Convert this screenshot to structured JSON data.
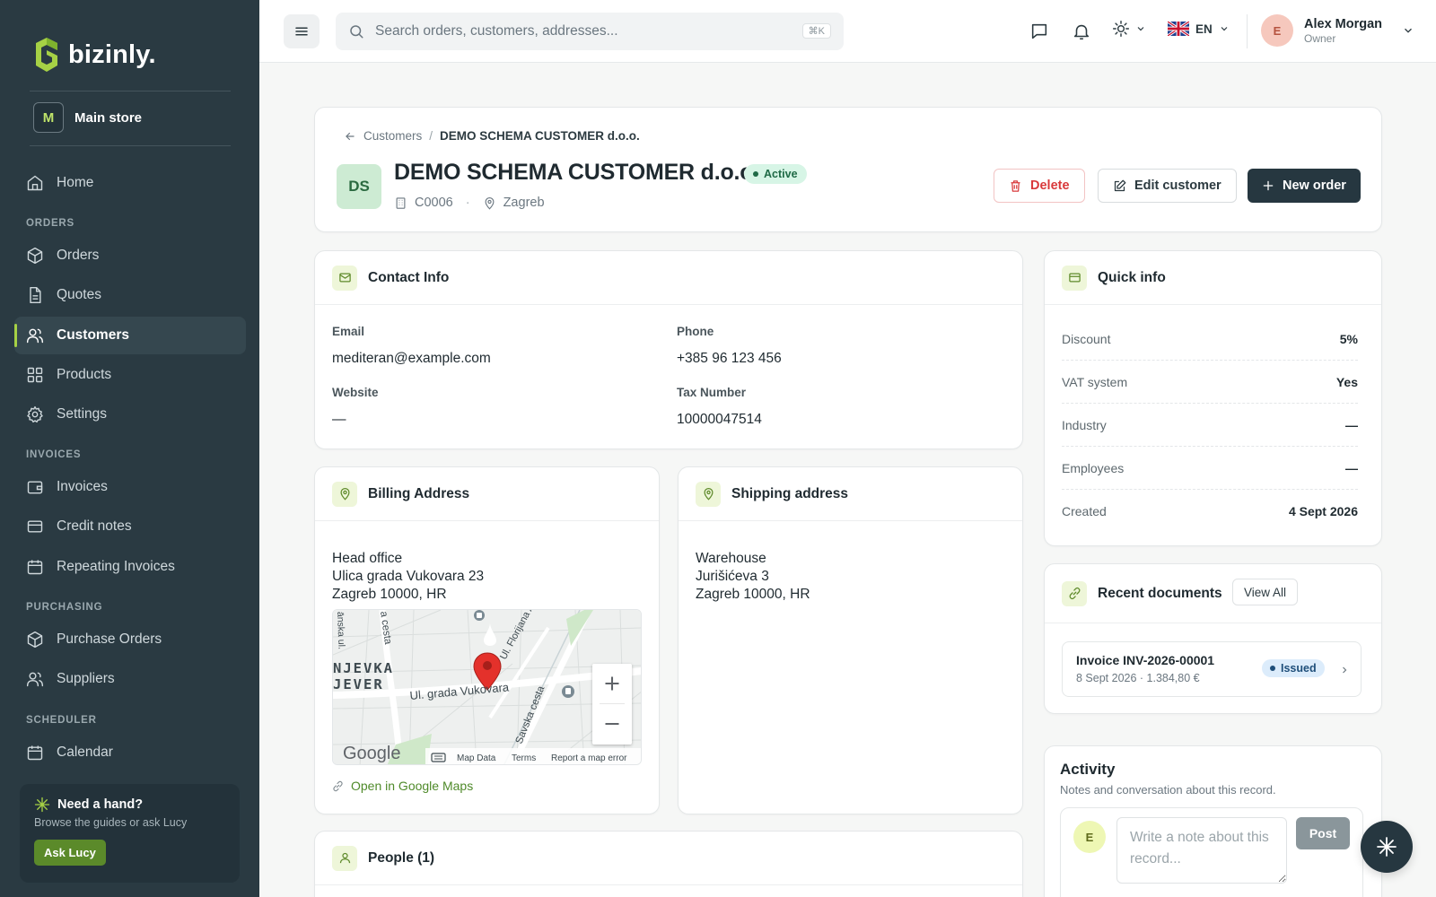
{
  "brand": {
    "name": "bizinly."
  },
  "store": {
    "badge": "M",
    "name": "Main store"
  },
  "nav": {
    "home": "Home",
    "section_orders": "ORDERS",
    "orders": "Orders",
    "quotes": "Quotes",
    "customers": "Customers",
    "products": "Products",
    "settings": "Settings",
    "section_invoices": "INVOICES",
    "invoices": "Invoices",
    "credit_notes": "Credit notes",
    "repeating_invoices": "Repeating Invoices",
    "section_purchasing": "PURCHASING",
    "purchase_orders": "Purchase Orders",
    "suppliers": "Suppliers",
    "section_scheduler": "SCHEDULER",
    "calendar": "Calendar"
  },
  "help": {
    "title": "Need a hand?",
    "subtitle": "Browse the guides or ask Lucy",
    "button": "Ask Lucy"
  },
  "topbar": {
    "search_placeholder": "Search orders, customers, addresses...",
    "shortcut": "⌘K",
    "language": "EN",
    "user_initial": "E",
    "user_name": "Alex Morgan",
    "user_role": "Owner"
  },
  "breadcrumb": {
    "parent": "Customers",
    "separator": "/",
    "current": "DEMO SCHEMA CUSTOMER d.o.o."
  },
  "customer": {
    "initials": "DS",
    "name": "DEMO SCHEMA CUSTOMER d.o.o.",
    "status": "Active",
    "code": "C0006",
    "meta_sep": "·",
    "city": "Zagreb"
  },
  "actions": {
    "delete": "Delete",
    "edit": "Edit customer",
    "new_order": "New order"
  },
  "contact": {
    "title": "Contact Info",
    "email_label": "Email",
    "email": "mediteran@example.com",
    "phone_label": "Phone",
    "phone": "+385 96 123 456",
    "website_label": "Website",
    "website": "—",
    "tax_label": "Tax Number",
    "tax": "10000047514"
  },
  "quick_info": {
    "title": "Quick info",
    "rows": [
      {
        "label": "Discount",
        "value": "5%"
      },
      {
        "label": "VAT system",
        "value": "Yes"
      },
      {
        "label": "Industry",
        "value": "—"
      },
      {
        "label": "Employees",
        "value": "—"
      },
      {
        "label": "Created",
        "value": "4 Sept 2026"
      }
    ]
  },
  "billing": {
    "title": "Billing Address",
    "line1": "Head office",
    "line2": "Ulica grada Vukovara 23",
    "line3": "Zagreb 10000, HR",
    "map_link": "Open in Google Maps"
  },
  "map": {
    "logo": "Google",
    "footer_data": "Map Data",
    "footer_terms": "Terms",
    "footer_report": "Report a map error",
    "street_main": "Ul. grada Vukovara",
    "street_savska": "Savska cesta",
    "street_florijana": "Ul. Florijana A",
    "street_cesta": "a cesta",
    "street_left": "ānska ul.",
    "district_1": "NJEVKA",
    "district_2": "JEVER"
  },
  "shipping": {
    "title": "Shipping address",
    "line1": "Warehouse",
    "line2": "Jurišićeva 3",
    "line3": "Zagreb 10000, HR"
  },
  "recent_docs": {
    "title": "Recent documents",
    "view_all": "View All",
    "items": [
      {
        "title": "Invoice INV-2026-00001",
        "subtitle": "8 Sept 2026 · 1.384,80 €",
        "status": "Issued"
      }
    ]
  },
  "people": {
    "title": "People (1)"
  },
  "activity": {
    "title": "Activity",
    "subtitle": "Notes and conversation about this record.",
    "avatar": "E",
    "placeholder": "Write a note about this record...",
    "post": "Post"
  },
  "colors": {
    "sidebar_bg": "#2a3a42",
    "accent_green": "#a6d145",
    "primary_dark": "#263740",
    "danger": "#d9393b",
    "active_badge_bg": "#d7f5e6",
    "issued_badge_bg": "#dcecfb"
  }
}
